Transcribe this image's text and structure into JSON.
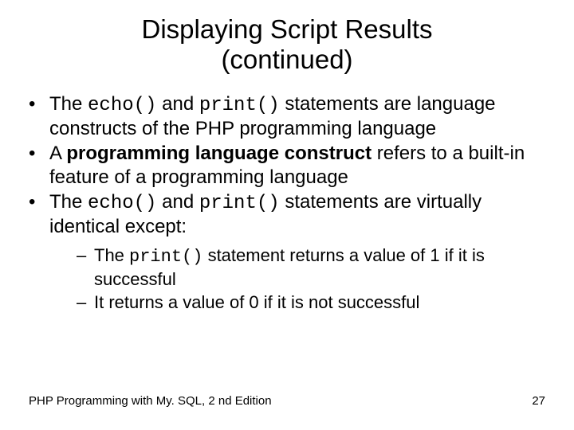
{
  "title_line1": "Displaying Script Results",
  "title_line2": "(continued)",
  "bullets": {
    "b1": {
      "pre": "The ",
      "code1": "echo()",
      "mid": " and ",
      "code2": "print()",
      "post": " statements are language constructs of the PHP programming language"
    },
    "b2": {
      "pre": "A ",
      "bold": "programming language construct",
      "post": " refers to a built-in feature of a programming language"
    },
    "b3": {
      "pre": "The ",
      "code1": "echo()",
      "mid": " and ",
      "code2": "print()",
      "post": " statements are virtually identical except:"
    }
  },
  "subs": {
    "s1": {
      "pre": "The ",
      "code": "print()",
      "post": " statement returns a value of 1 if it is successful"
    },
    "s2": {
      "text": "It returns a value of 0 if it is not successful"
    }
  },
  "footer": {
    "left": "PHP Programming with My. SQL, 2 nd Edition",
    "right": "27"
  }
}
